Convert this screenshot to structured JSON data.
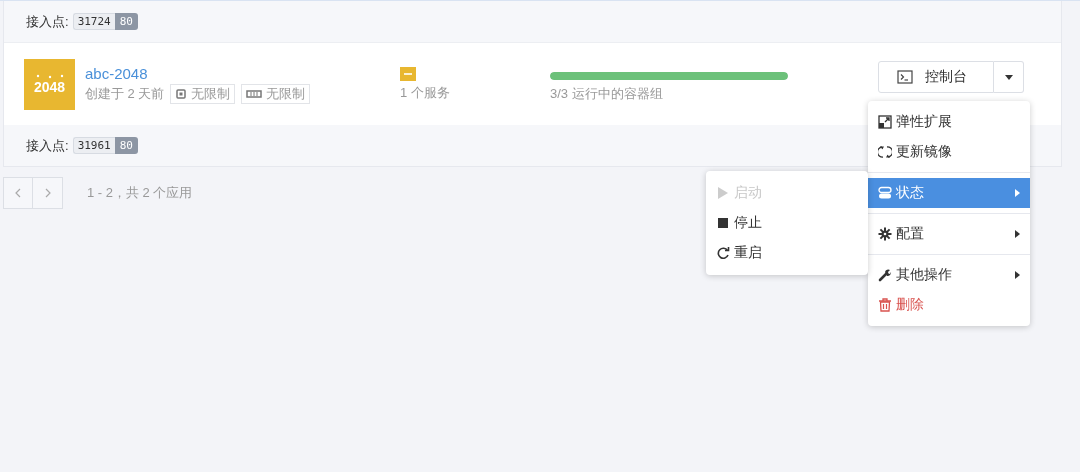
{
  "endpoints_top": {
    "label": "接入点:",
    "port": "31724",
    "target": "80"
  },
  "app": {
    "logo": "2048",
    "name": "abc-2048",
    "created": "创建于 2 天前",
    "cpu": "无限制",
    "memory": "无限制",
    "services": "1 个服务",
    "pods": {
      "level": 1,
      "text": "3/3 运行中的容器组"
    },
    "console_button": "控制台"
  },
  "endpoints_bottom": {
    "label": "接入点:",
    "port": "31961",
    "target": "80"
  },
  "pagination": {
    "text": "1 - 2，共 2 个应用"
  },
  "menu": {
    "groups": [
      [
        {
          "kind": "scale",
          "label": "弹性扩展",
          "submenu": false,
          "selected": false
        },
        {
          "kind": "update",
          "label": "更新镜像",
          "submenu": false,
          "selected": false
        }
      ],
      [
        {
          "kind": "status",
          "label": "状态",
          "submenu": true,
          "selected": true
        }
      ],
      [
        {
          "kind": "config",
          "label": "配置",
          "submenu": true,
          "selected": false
        }
      ],
      [
        {
          "kind": "other",
          "label": "其他操作",
          "submenu": true,
          "selected": false
        },
        {
          "kind": "delete",
          "label": "删除",
          "submenu": false,
          "selected": false
        }
      ]
    ]
  },
  "submenu": {
    "items": [
      {
        "kind": "start",
        "label": "启动",
        "disabled": true
      },
      {
        "kind": "stop",
        "label": "停止",
        "disabled": false
      },
      {
        "kind": "restart",
        "label": "重启",
        "disabled": false
      }
    ]
  }
}
